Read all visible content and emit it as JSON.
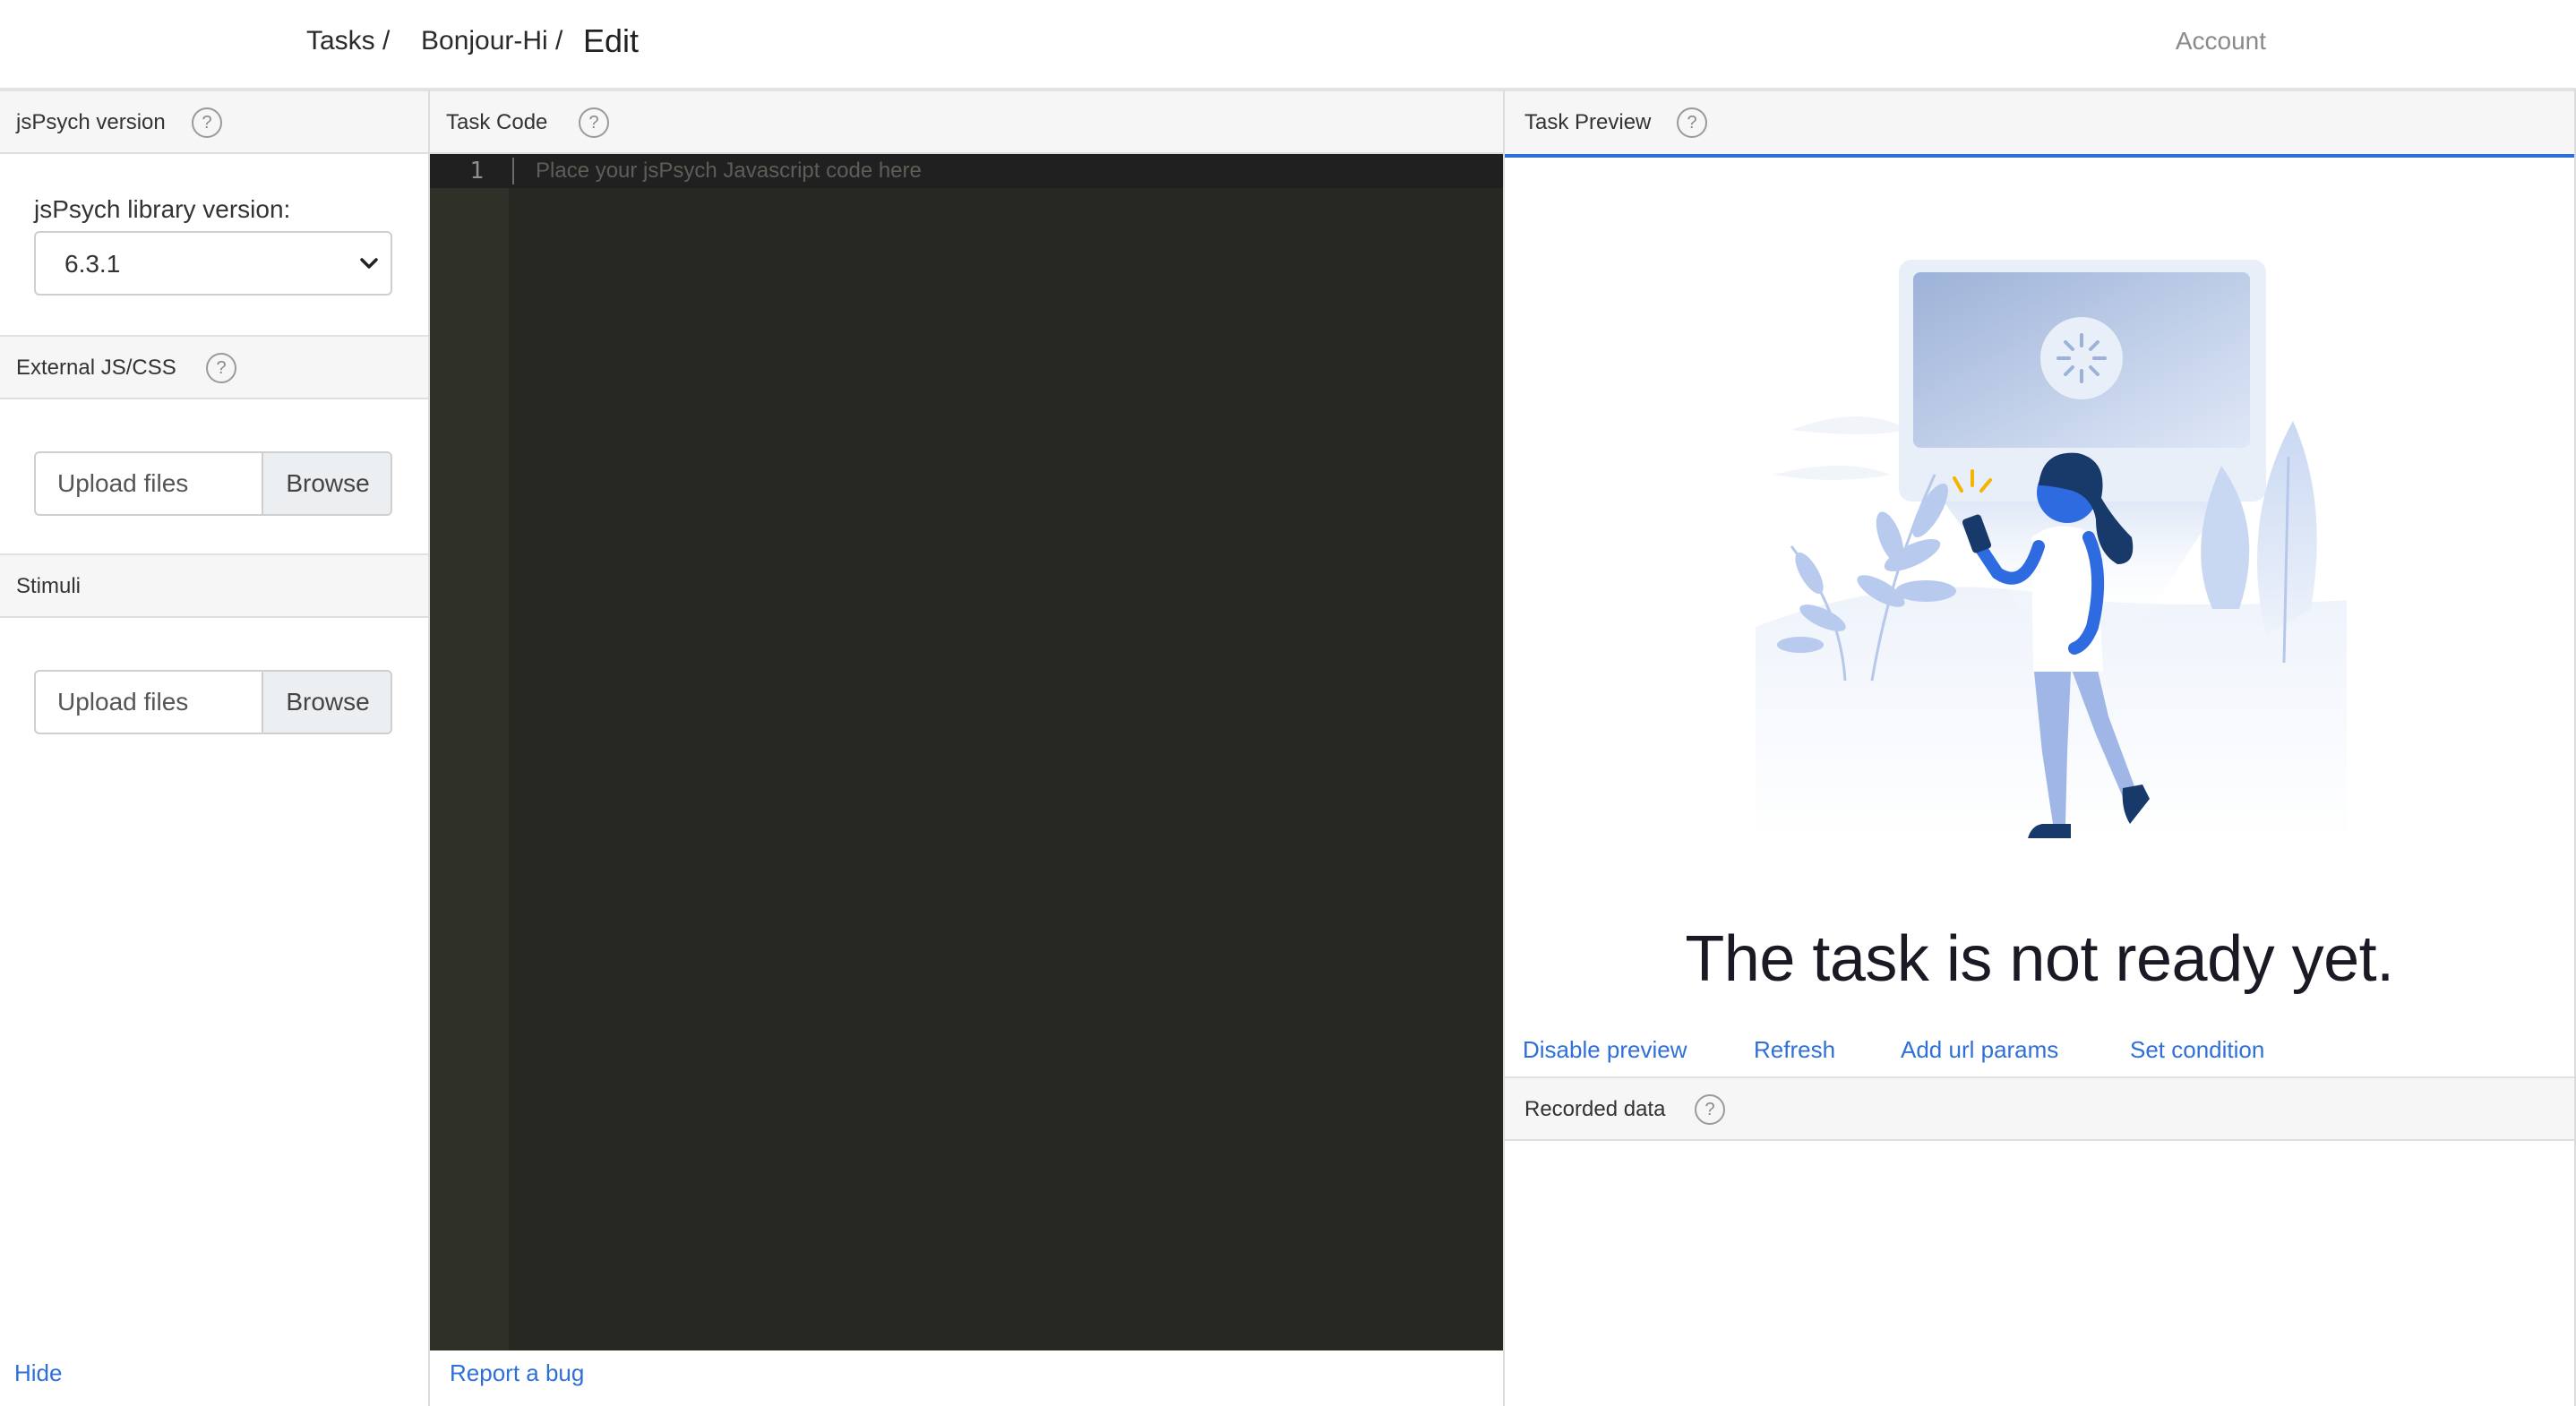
{
  "breadcrumb": {
    "tasks": "Tasks /",
    "task_name": "Bonjour-Hi /",
    "current": "Edit"
  },
  "nav": {
    "account": "Account"
  },
  "left_panel": {
    "version_section": {
      "title": "jsPsych version",
      "help": "?"
    },
    "library_label": "jsPsych library version:",
    "library_selected": "6.3.1",
    "external_section": {
      "title": "External JS/CSS",
      "help": "?"
    },
    "external_upload": {
      "placeholder": "Upload files",
      "browse": "Browse"
    },
    "stimuli_section": {
      "title": "Stimuli"
    },
    "stimuli_upload": {
      "placeholder": "Upload files",
      "browse": "Browse"
    },
    "hide": "Hide"
  },
  "code_panel": {
    "title": "Task Code",
    "help": "?",
    "line_number": "1",
    "placeholder": "Place your jsPsych Javascript code here",
    "report_bug": "Report a bug"
  },
  "preview_panel": {
    "title": "Task Preview",
    "help": "?",
    "message": "The task is not ready yet.",
    "actions": {
      "disable_preview": "Disable preview",
      "refresh": "Refresh",
      "add_url_params": "Add url params",
      "set_condition": "Set condition"
    },
    "recorded_data": {
      "title": "Recorded data",
      "help": "?"
    }
  },
  "icons": {
    "help": "question-circle-icon",
    "select": "chevron-down-icon",
    "illustration": "loading-screen-illustration"
  },
  "colors": {
    "link": "#2f6fd8",
    "editor_bg": "#272822",
    "gutter_bg": "#2f3129",
    "accent": "#2f6fd8"
  }
}
